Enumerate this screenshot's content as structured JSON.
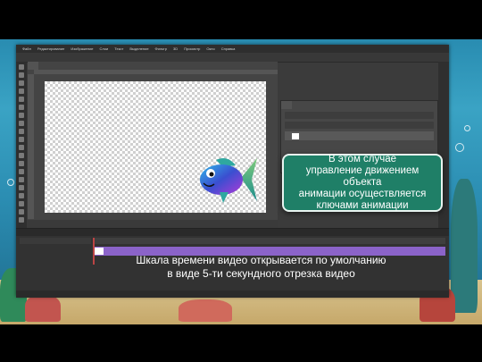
{
  "colors": {
    "callout_bg": "#1f7f67",
    "clip_purple": "#8b63c9",
    "ps_dark": "#3b3b3b"
  },
  "photoshop": {
    "menu": [
      "Файл",
      "Редактирование",
      "Изображение",
      "Слои",
      "Текст",
      "Выделение",
      "Фильтр",
      "3D",
      "Просмотр",
      "Окно",
      "Справка"
    ]
  },
  "callout": {
    "text": "В этом случае\nуправление движением объекта\nанимации осуществляется\nключами анимации"
  },
  "caption": {
    "text": "Шкала времени видео открывается по умолчанию\nв виде 5-ти секундного отрезка видео"
  }
}
